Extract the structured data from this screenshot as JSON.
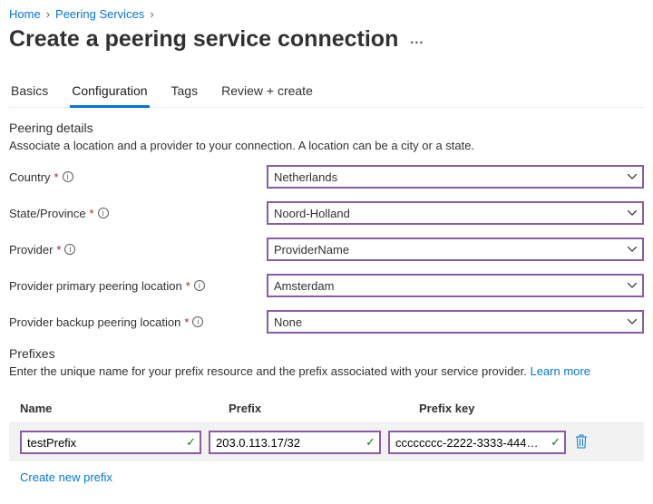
{
  "breadcrumb": {
    "items": [
      {
        "label": "Home"
      },
      {
        "label": "Peering Services"
      }
    ]
  },
  "page": {
    "title": "Create a peering service connection"
  },
  "tabs": {
    "items": [
      {
        "label": "Basics",
        "active": false
      },
      {
        "label": "Configuration",
        "active": true
      },
      {
        "label": "Tags",
        "active": false
      },
      {
        "label": "Review + create",
        "active": false
      }
    ]
  },
  "peering_details": {
    "heading": "Peering details",
    "description": "Associate a location and a provider to your connection. A location can be a city or a state."
  },
  "fields": {
    "country": {
      "label": "Country",
      "value": "Netherlands",
      "required": true
    },
    "state": {
      "label": "State/Province",
      "value": "Noord-Holland",
      "required": true
    },
    "provider": {
      "label": "Provider",
      "value": "ProviderName",
      "required": true
    },
    "primary": {
      "label": "Provider primary peering location",
      "value": "Amsterdam",
      "required": true
    },
    "backup": {
      "label": "Provider backup peering location",
      "value": "None",
      "required": true
    }
  },
  "prefixes": {
    "heading": "Prefixes",
    "description_pre": "Enter the unique name for your prefix resource and the prefix associated with your service provider. ",
    "learn_more": "Learn more",
    "columns": {
      "name": "Name",
      "prefix": "Prefix",
      "key": "Prefix key"
    },
    "row": {
      "name": "testPrefix",
      "prefix": "203.0.113.17/32",
      "key": "cccccccc-2222-3333-4444-d..."
    },
    "create_link": "Create new prefix"
  }
}
